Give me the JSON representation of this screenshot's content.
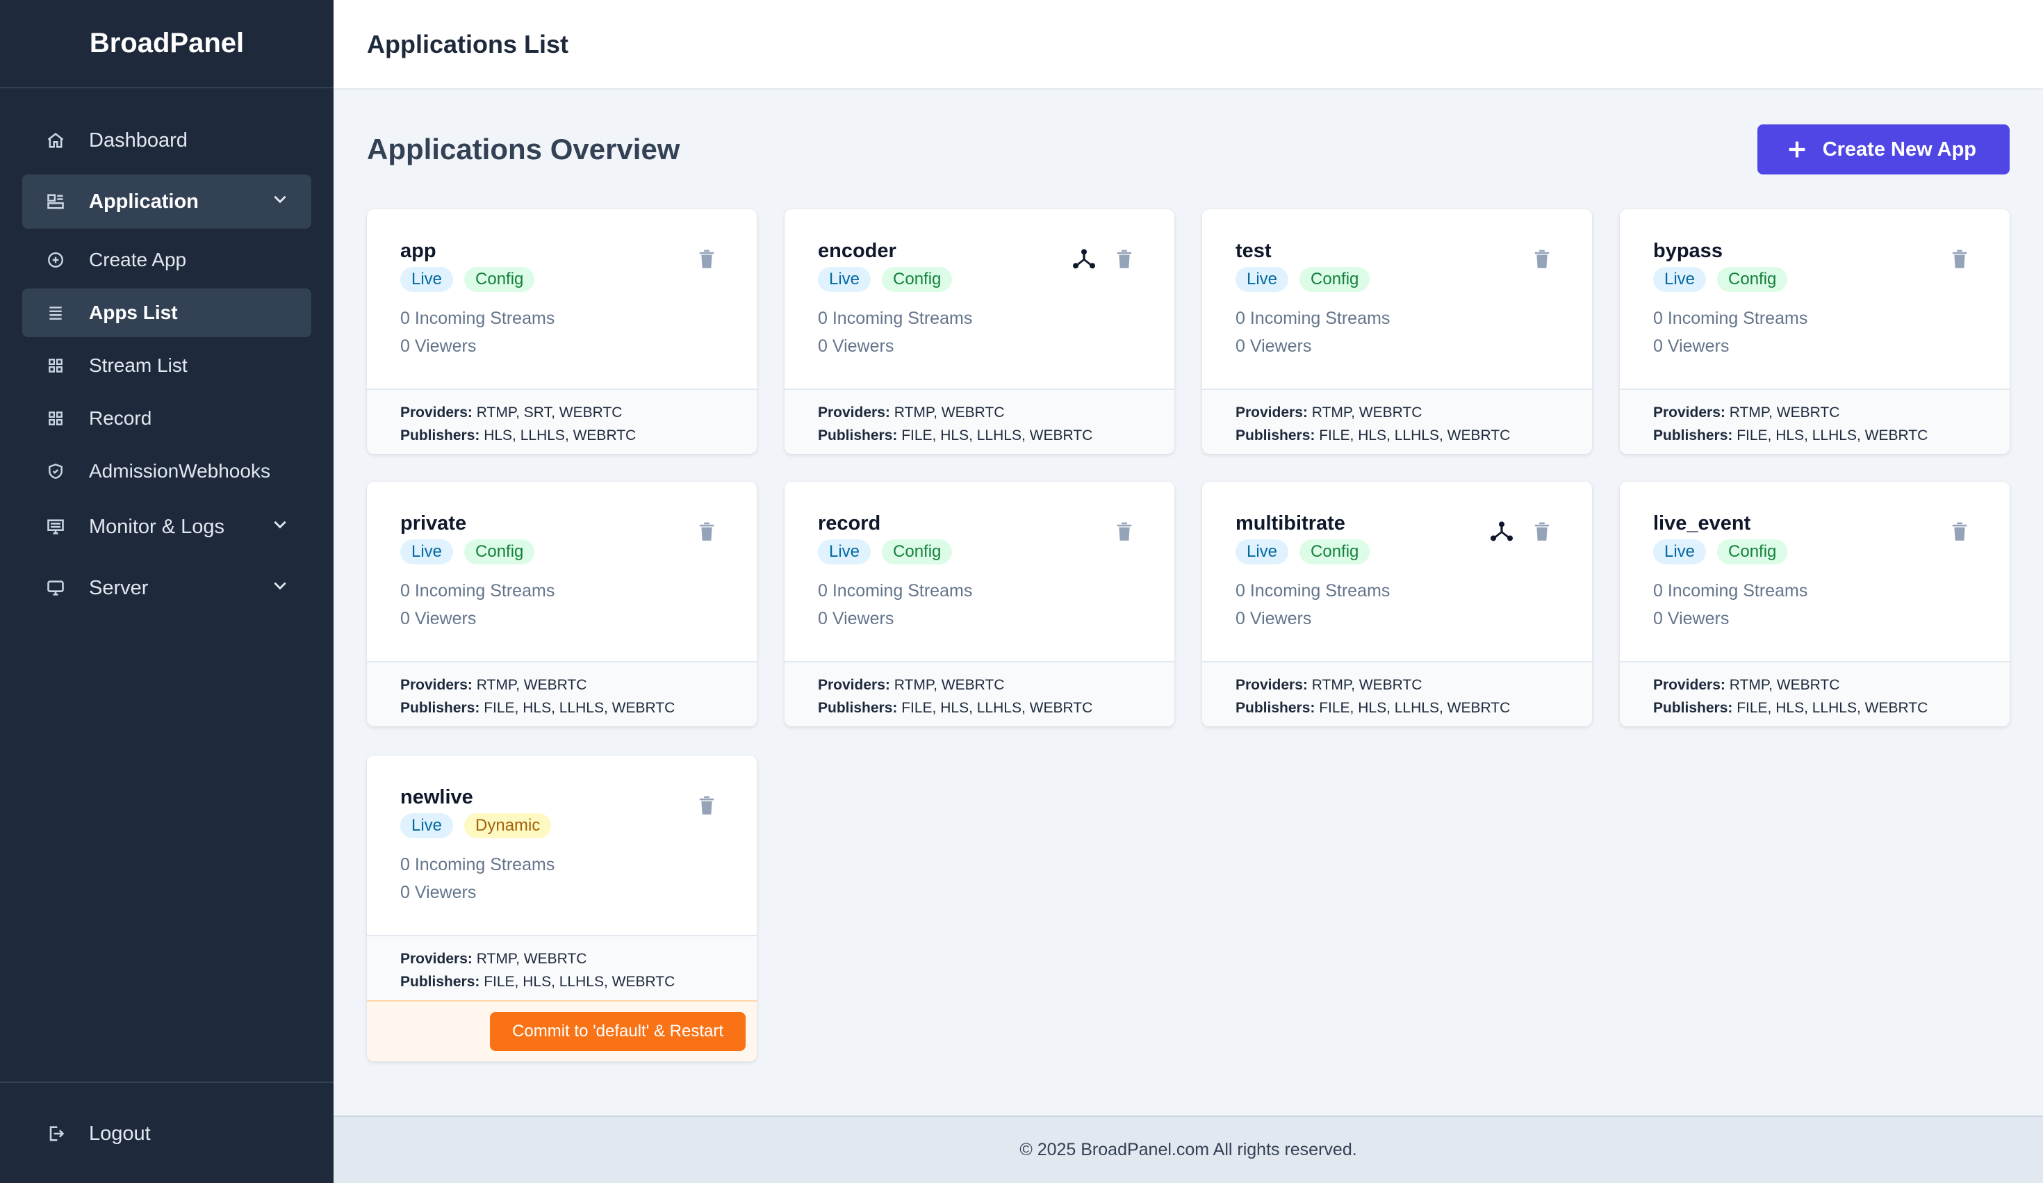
{
  "brand": "BroadPanel",
  "sidebar": {
    "items": [
      {
        "label": "Dashboard",
        "icon": "home-icon"
      },
      {
        "label": "Application",
        "icon": "app-icon"
      },
      {
        "label": "Monitor & Logs",
        "icon": "monitor-icon"
      },
      {
        "label": "Server",
        "icon": "server-icon"
      }
    ],
    "sub_items": [
      {
        "label": "Create App",
        "icon": "plus-circle-icon"
      },
      {
        "label": "Apps List",
        "icon": "list-icon"
      },
      {
        "label": "Stream List",
        "icon": "grid-icon"
      },
      {
        "label": "Record",
        "icon": "grid-icon"
      },
      {
        "label": "AdmissionWebhooks",
        "icon": "shield-icon"
      }
    ],
    "logout": "Logout"
  },
  "header": {
    "title": "Applications List"
  },
  "main": {
    "heading": "Applications Overview",
    "create_button": "Create New App",
    "cards": [
      {
        "name": "app",
        "badges": [
          "Live",
          "Config"
        ],
        "streams": "0 Incoming Streams",
        "viewers": "0 Viewers",
        "providers_label": "Providers:",
        "providers": " RTMP, SRT, WEBRTC",
        "publishers_label": "Publishers:",
        "publishers": " HLS, LLHLS, WEBRTC"
      },
      {
        "name": "encoder",
        "badges": [
          "Live",
          "Config"
        ],
        "streams": "0 Incoming Streams",
        "viewers": "0 Viewers",
        "providers_label": "Providers:",
        "providers": " RTMP, WEBRTC",
        "publishers_label": "Publishers:",
        "publishers": " FILE, HLS, LLHLS, WEBRTC"
      },
      {
        "name": "test",
        "badges": [
          "Live",
          "Config"
        ],
        "streams": "0 Incoming Streams",
        "viewers": "0 Viewers",
        "providers_label": "Providers:",
        "providers": " RTMP, WEBRTC",
        "publishers_label": "Publishers:",
        "publishers": " FILE, HLS, LLHLS, WEBRTC"
      },
      {
        "name": "bypass",
        "badges": [
          "Live",
          "Config"
        ],
        "streams": "0 Incoming Streams",
        "viewers": "0 Viewers",
        "providers_label": "Providers:",
        "providers": " RTMP, WEBRTC",
        "publishers_label": "Publishers:",
        "publishers": " FILE, HLS, LLHLS, WEBRTC"
      },
      {
        "name": "private",
        "badges": [
          "Live",
          "Config"
        ],
        "streams": "0 Incoming Streams",
        "viewers": "0 Viewers",
        "providers_label": "Providers:",
        "providers": " RTMP, WEBRTC",
        "publishers_label": "Publishers:",
        "publishers": " FILE, HLS, LLHLS, WEBRTC"
      },
      {
        "name": "record",
        "badges": [
          "Live",
          "Config"
        ],
        "streams": "0 Incoming Streams",
        "viewers": "0 Viewers",
        "providers_label": "Providers:",
        "providers": " RTMP, WEBRTC",
        "publishers_label": "Publishers:",
        "publishers": " FILE, HLS, LLHLS, WEBRTC"
      },
      {
        "name": "multibitrate",
        "badges": [
          "Live",
          "Config"
        ],
        "streams": "0 Incoming Streams",
        "viewers": "0 Viewers",
        "providers_label": "Providers:",
        "providers": " RTMP, WEBRTC",
        "publishers_label": "Publishers:",
        "publishers": " FILE, HLS, LLHLS, WEBRTC"
      },
      {
        "name": "live_event",
        "badges": [
          "Live",
          "Config"
        ],
        "streams": "0 Incoming Streams",
        "viewers": "0 Viewers",
        "providers_label": "Providers:",
        "providers": " RTMP, WEBRTC",
        "publishers_label": "Publishers:",
        "publishers": " FILE, HLS, LLHLS, WEBRTC"
      },
      {
        "name": "newlive",
        "badges": [
          "Live",
          "Dynamic"
        ],
        "streams": "0 Incoming Streams",
        "viewers": "0 Viewers",
        "providers_label": "Providers:",
        "providers": " RTMP, WEBRTC",
        "publishers_label": "Publishers:",
        "publishers": " FILE, HLS, LLHLS, WEBRTC",
        "commit_button": "Commit to 'default' & Restart"
      }
    ]
  },
  "footer": {
    "text": "© 2025 BroadPanel.com All rights reserved."
  },
  "colors": {
    "sidebar_bg": "#1e293b",
    "accent": "#4f46e5",
    "commit": "#f97316"
  }
}
